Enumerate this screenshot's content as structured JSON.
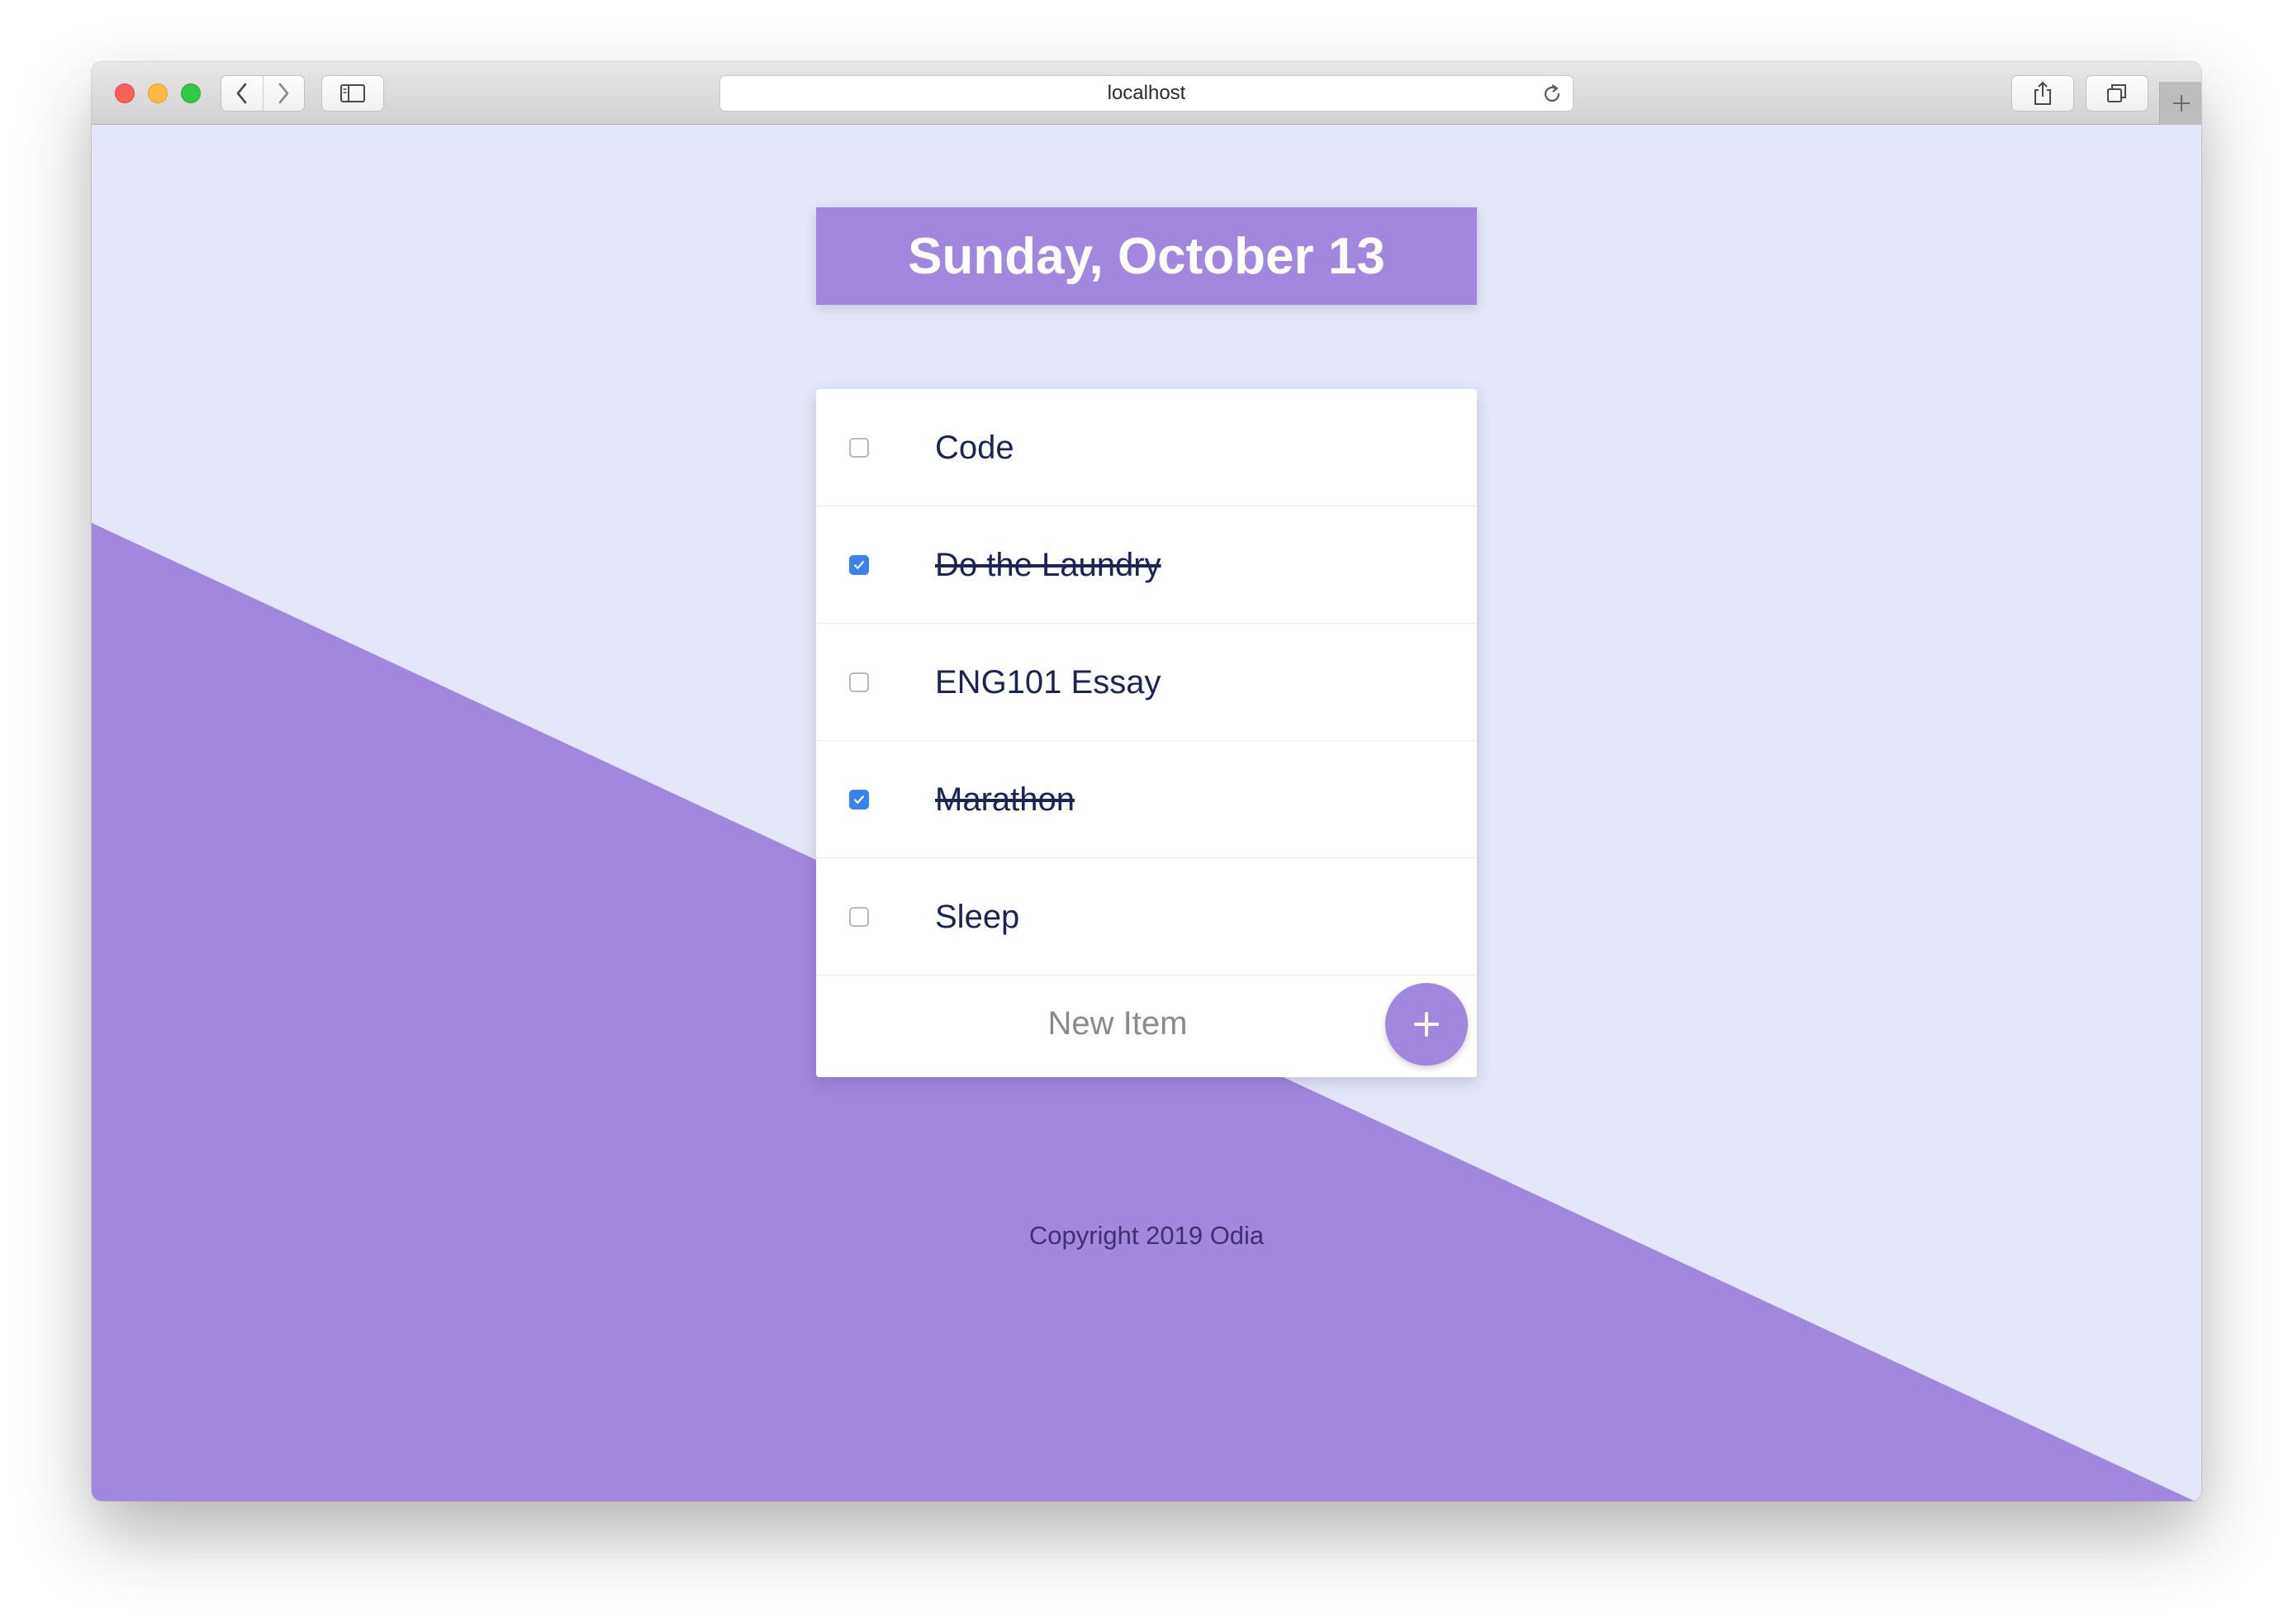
{
  "browser": {
    "url": "localhost",
    "icons": {
      "back": "chevron-left-icon",
      "forward": "chevron-right-icon",
      "sidebar": "sidebar-icon",
      "reload": "reload-icon",
      "share": "share-icon",
      "tabs": "tabs-icon",
      "new_tab": "plus-icon"
    }
  },
  "app": {
    "date_title": "Sunday, October 13",
    "items": [
      {
        "label": "Code",
        "checked": false
      },
      {
        "label": "Do the Laundry",
        "checked": true
      },
      {
        "label": "ENG101 Essay",
        "checked": false
      },
      {
        "label": "Marathon",
        "checked": true
      },
      {
        "label": "Sleep",
        "checked": false
      }
    ],
    "new_item_placeholder": "New Item",
    "add_button_symbol": "+",
    "footer": "Copyright 2019 Odia"
  },
  "colors": {
    "accent": "#a187dd",
    "background": "#e4e7f9",
    "text": "#1b2457",
    "checkbox_checked": "#3b82f0"
  }
}
